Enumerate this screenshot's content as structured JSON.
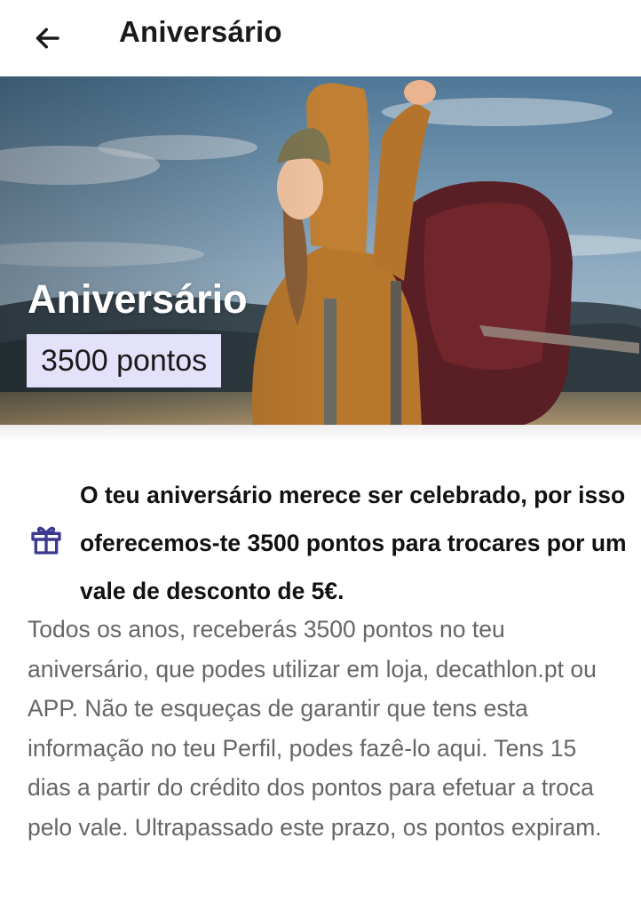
{
  "header": {
    "title": "Aniversário",
    "back_icon": "arrow-left-icon"
  },
  "hero": {
    "image": "photo: smiling woman with beanie and backpack, arms raised, mountain landscape",
    "title": "Aniversário",
    "points_badge": "3500 pontos"
  },
  "content": {
    "gift_icon": "gift-icon",
    "accent_color": "#3b3a8f",
    "highlight": "O teu aniversário merece ser celebrado, por isso oferecemos-te 3500 pontos para trocares por um vale de desconto de 5€.",
    "body": "Todos os anos, receberás 3500 pontos no teu aniversário, que podes utilizar em loja, decathlon.pt ou APP. Não te esqueças de garantir que tens esta informação no teu Perfil, podes fazê-lo aqui. Tens 15 dias a partir do crédito dos pontos para efetuar a troca pelo vale. Ultrapassado este prazo, os pontos expiram."
  }
}
